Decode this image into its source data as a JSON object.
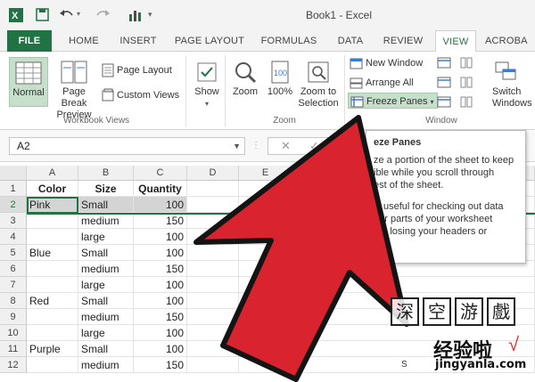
{
  "app": {
    "title": "Book1 - Excel"
  },
  "tabs": [
    "FILE",
    "HOME",
    "INSERT",
    "PAGE LAYOUT",
    "FORMULAS",
    "DATA",
    "REVIEW",
    "VIEW",
    "ACROBA"
  ],
  "ribbon": {
    "workbook_views": {
      "normal": "Normal",
      "page_break_1": "Page Break",
      "page_break_2": "Preview",
      "page_layout": "Page Layout",
      "custom_views": "Custom Views",
      "label": "Workbook Views"
    },
    "show": {
      "label": "Show"
    },
    "zoom": {
      "zoom": "Zoom",
      "hundred": "100%",
      "zoom_sel_1": "Zoom to",
      "zoom_sel_2": "Selection",
      "label": "Zoom"
    },
    "window": {
      "new_window": "New Window",
      "arrange_all": "Arrange All",
      "freeze_panes": "Freeze Panes",
      "switch_1": "Switch",
      "switch_2": "Windows",
      "label": "Window"
    }
  },
  "formula_bar": {
    "name_box": "A2"
  },
  "columns": [
    "A",
    "B",
    "C",
    "D",
    "E"
  ],
  "rows": [
    {
      "n": "1",
      "a": "Color",
      "b": "Size",
      "c": "Quantity"
    },
    {
      "n": "2",
      "a": "Pink",
      "b": "Small",
      "c": "100"
    },
    {
      "n": "3",
      "a": "",
      "b": "medium",
      "c": "150"
    },
    {
      "n": "4",
      "a": "",
      "b": "large",
      "c": "100"
    },
    {
      "n": "5",
      "a": "Blue",
      "b": "Small",
      "c": "100"
    },
    {
      "n": "6",
      "a": "",
      "b": "medium",
      "c": "150"
    },
    {
      "n": "7",
      "a": "",
      "b": "large",
      "c": "100"
    },
    {
      "n": "8",
      "a": "Red",
      "b": "Small",
      "c": "100"
    },
    {
      "n": "9",
      "a": "",
      "b": "medium",
      "c": "150"
    },
    {
      "n": "10",
      "a": "",
      "b": "large",
      "c": "100"
    },
    {
      "n": "11",
      "a": "Purple",
      "b": "Small",
      "c": "100"
    },
    {
      "n": "12",
      "a": "",
      "b": "medium",
      "c": "150"
    }
  ],
  "tooltip": {
    "title": "eze Panes",
    "line1": "ze a portion of the sheet to keep",
    "line2": "ible while you scroll through",
    "line3": "est of the sheet.",
    "line4": "is useful for checking out data",
    "line5": "her parts of your worksheet",
    "line6": "out losing your headers or"
  },
  "watermark": {
    "c1": "深",
    "c2": "空",
    "c3": "游",
    "c4": "戲",
    "brand": "经验啦",
    "check": "√",
    "s": "S",
    "url": "jingyanla.com"
  },
  "colors": {
    "excel_green": "#217346",
    "arrow_red": "#d9232e",
    "selection_gray": "#d4d4d4"
  }
}
